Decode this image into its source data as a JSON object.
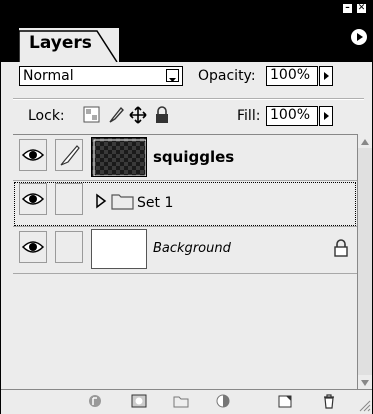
{
  "palette": {
    "window_buttons": {
      "minimize": "–",
      "close": "✕"
    },
    "tab": {
      "label": "Layers"
    },
    "blend_mode": {
      "selected": "Normal"
    },
    "opacity": {
      "label": "Opacity:",
      "value": "100%"
    },
    "lock": {
      "label": "Lock:",
      "icons": [
        "lock-transparency-icon",
        "lock-paint-brush-icon",
        "lock-move-icon",
        "lock-all-icon"
      ]
    },
    "fill": {
      "label": "Fill:",
      "value": "100%"
    },
    "layers": [
      {
        "name": "squiggles",
        "visible": true,
        "linked_brush": true,
        "thumb": "checker-dark",
        "bold": true
      },
      {
        "name": "Set 1",
        "visible": true,
        "type": "group",
        "collapsed": true
      },
      {
        "name": "Background",
        "visible": true,
        "italic": true,
        "locked": true,
        "thumb": "white"
      }
    ],
    "footer_icons": [
      "layer-style-icon",
      "add-mask-icon",
      "new-set-icon",
      "adjustment-layer-icon",
      "new-layer-icon",
      "trash-icon"
    ]
  },
  "colors": {
    "accent": "#000000",
    "panel": "#ececec"
  }
}
